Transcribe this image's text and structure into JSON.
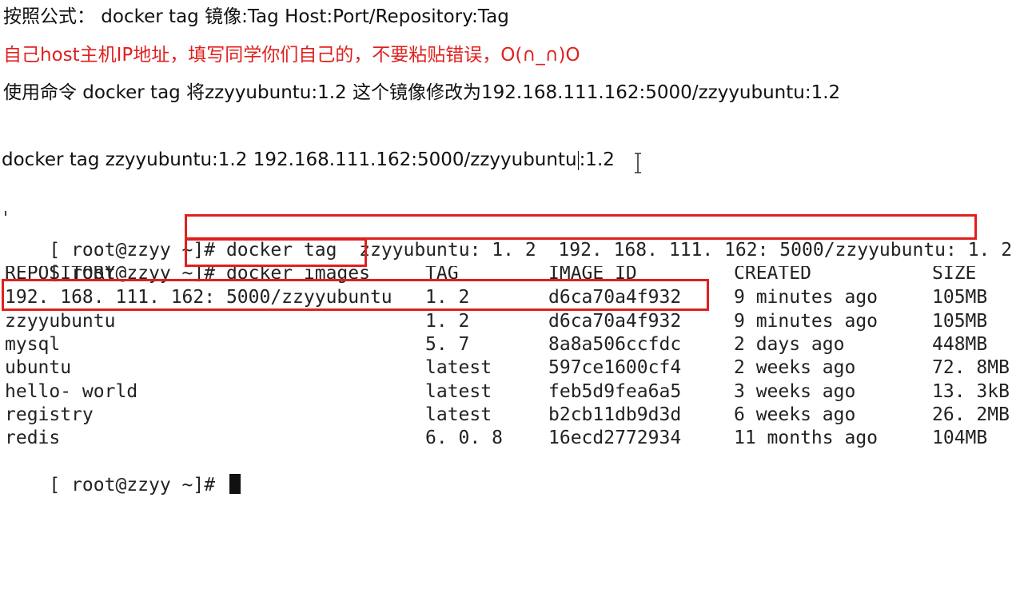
{
  "notes": {
    "formula": "按照公式： docker   tag   镜像:Tag   Host:Port/Repository:Tag",
    "warning": "自己host主机IP地址，填写同学你们自己的，不要粘贴错误，O(∩_∩)O",
    "instruction": "使用命令 docker tag 将zzyyubuntu:1.2 这个镜像修改为192.168.111.162:5000/zzyyubuntu:1.2",
    "command_before_caret": "docker tag  zzyyubuntu:1.2  192.168.111.162:5000/zzyyubuntu",
    "command_after_caret": ":1.2",
    "warning_color": "#e0201e"
  },
  "terminal": {
    "prompt": "[ root@zzyy ~]# ",
    "command1": "docker tag  zzyyubuntu: 1. 2  192. 168. 111. 162: 5000/zzyyubuntu: 1. 2",
    "command2": "docker images",
    "headers": {
      "repository": "REPOSITORY",
      "tag": "TAG",
      "image_id": "IMAGE ID",
      "created": "CREATED",
      "size": "SIZE"
    },
    "rows": [
      {
        "repository": "192. 168. 111. 162: 5000/zzyyubuntu",
        "tag": "1. 2",
        "image_id": "d6ca70a4f932",
        "created": "9 minutes ago",
        "size": "105MB"
      },
      {
        "repository": "zzyyubuntu",
        "tag": "1. 2",
        "image_id": "d6ca70a4f932",
        "created": "9 minutes ago",
        "size": "105MB"
      },
      {
        "repository": "mysql",
        "tag": "5. 7",
        "image_id": "8a8a506ccfdc",
        "created": "2 days ago",
        "size": "448MB"
      },
      {
        "repository": "ubuntu",
        "tag": "latest",
        "image_id": "597ce1600cf4",
        "created": "2 weeks ago",
        "size": "72. 8MB"
      },
      {
        "repository": "hello- world",
        "tag": "latest",
        "image_id": "feb5d9fea6a5",
        "created": "3 weeks ago",
        "size": "13. 3kB"
      },
      {
        "repository": "registry",
        "tag": "latest",
        "image_id": "b2cb11db9d3d",
        "created": "6 weeks ago",
        "size": "26. 2MB"
      },
      {
        "repository": "redis",
        "tag": "6. 0. 8",
        "image_id": "16ecd2772934",
        "created": "11 months ago",
        "size": "104MB"
      }
    ],
    "highlight_color": "#e0201e"
  }
}
